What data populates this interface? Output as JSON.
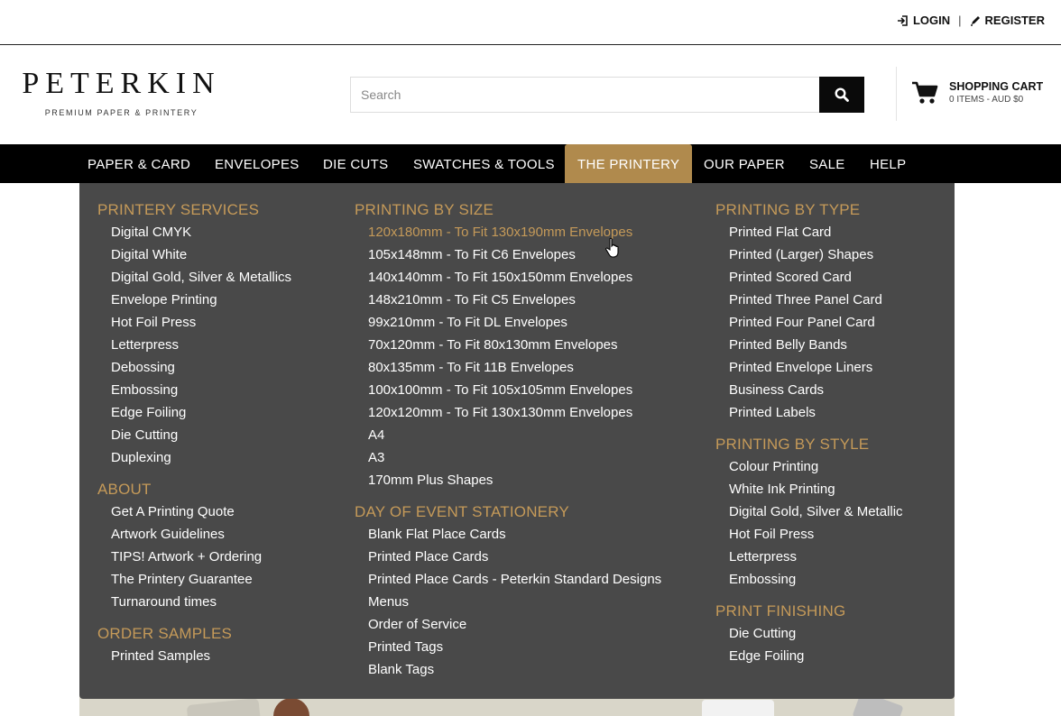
{
  "toplinks": {
    "login": "LOGIN",
    "separator": "|",
    "register": "REGISTER"
  },
  "logo": {
    "name": "PETERKIN",
    "tagline": "PREMIUM PAPER & PRINTERY"
  },
  "search": {
    "placeholder": "Search",
    "icon": "search-icon"
  },
  "cart": {
    "title": "SHOPPING CART",
    "summary": "0 ITEMS - AUD $0",
    "icon": "cart-icon"
  },
  "nav": {
    "items": [
      "PAPER & CARD",
      "ENVELOPES",
      "DIE CUTS",
      "SWATCHES & TOOLS",
      "THE PRINTERY",
      "OUR PAPER",
      "SALE",
      "HELP"
    ],
    "active": "THE PRINTERY"
  },
  "colors": {
    "accent": "#b08a4d",
    "menu_bg": "#494949",
    "heading": "#c59a59"
  },
  "menu": {
    "col1": {
      "printery_services": {
        "title": "PRINTERY SERVICES",
        "items": [
          "Digital CMYK",
          "Digital White",
          "Digital Gold, Silver & Metallics",
          "Envelope Printing",
          "Hot Foil Press",
          "Letterpress",
          "Debossing",
          "Embossing",
          "Edge Foiling",
          "Die Cutting",
          "Duplexing"
        ]
      },
      "about": {
        "title": "ABOUT",
        "items": [
          "Get A Printing Quote",
          "Artwork Guidelines",
          "TIPS! Artwork + Ordering",
          "The Printery Guarantee",
          "Turnaround times"
        ]
      },
      "order_samples": {
        "title": "ORDER SAMPLES",
        "items": [
          "Printed Samples"
        ]
      }
    },
    "col2": {
      "printing_by_size": {
        "title": "PRINTING BY SIZE",
        "items": [
          "120x180mm - To Fit 130x190mm Envelopes",
          "105x148mm - To Fit C6 Envelopes",
          "140x140mm - To Fit 150x150mm Envelopes",
          "148x210mm - To Fit C5 Envelopes",
          "99x210mm - To Fit DL Envelopes",
          "70x120mm - To Fit 80x130mm Envelopes",
          "80x135mm - To Fit 11B Envelopes",
          "100x100mm - To Fit 105x105mm Envelopes",
          "120x120mm - To Fit 130x130mm Envelopes",
          "A4",
          "A3",
          "170mm Plus Shapes"
        ]
      },
      "day_of_event": {
        "title": "DAY OF EVENT STATIONERY",
        "items": [
          "Blank Flat Place Cards",
          "Printed Place Cards",
          "Printed Place Cards - Peterkin Standard Designs",
          "Menus",
          "Order of Service",
          "Printed Tags",
          "Blank Tags"
        ]
      }
    },
    "col3": {
      "printing_by_type": {
        "title": "PRINTING BY TYPE",
        "items": [
          "Printed Flat Card",
          "Printed (Larger) Shapes",
          "Printed Scored Card",
          "Printed Three Panel Card",
          "Printed Four Panel Card",
          "Printed Belly Bands",
          "Printed Envelope Liners",
          "Business Cards",
          "Printed Labels"
        ]
      },
      "printing_by_style": {
        "title": "PRINTING BY STYLE",
        "items": [
          "Colour Printing",
          "White Ink Printing",
          "Digital Gold, Silver & Metallic",
          "Hot Foil Press",
          "Letterpress",
          "Embossing"
        ]
      },
      "print_finishing": {
        "title": "PRINT FINISHING",
        "items": [
          "Die Cutting",
          "Edge Foiling"
        ]
      }
    }
  }
}
